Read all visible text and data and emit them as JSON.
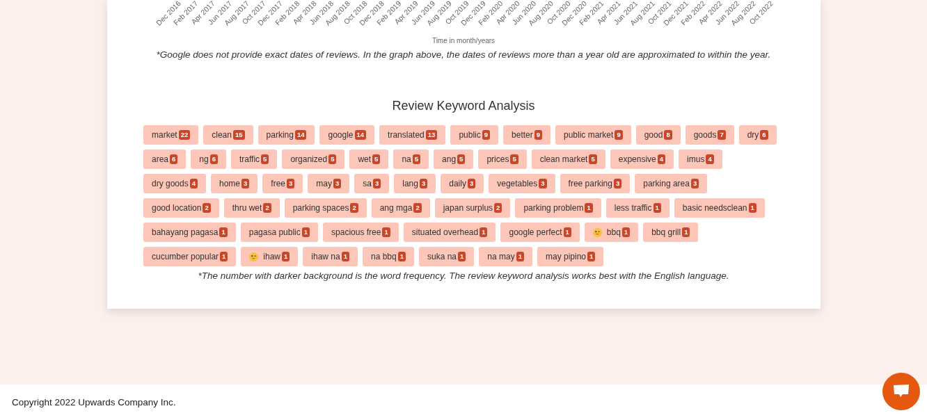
{
  "chart_axis": {
    "ticks": [
      "Dec 2016",
      "Feb 2017",
      "Apr 2017",
      "Jun 2017",
      "Aug 2017",
      "Oct 2017",
      "Dec 2017",
      "Feb 2018",
      "Apr 2018",
      "Jun 2018",
      "Aug 2018",
      "Oct 2018",
      "Dec 2018",
      "Feb 2019",
      "Apr 2019",
      "Jun 2019",
      "Aug 2019",
      "Oct 2019",
      "Dec 2019",
      "Feb 2020",
      "Apr 2020",
      "Jun 2020",
      "Aug 2020",
      "Oct 2020",
      "Dec 2020",
      "Feb 2021",
      "Apr 2021",
      "Jun 2021",
      "Aug 2021",
      "Oct 2021",
      "Dec 2021",
      "Feb 2022",
      "Apr 2022",
      "Jun 2022",
      "Aug 2022",
      "Oct 2022"
    ],
    "label": "Time in month/years"
  },
  "chart_note": "*Google does not provide exact dates of reviews. In the graph above, the dates of reviews more than a year old are approximated to within the year.",
  "keyword_title": "Review Keyword Analysis",
  "keywords": [
    {
      "word": "market",
      "count": "22",
      "kind": "word"
    },
    {
      "word": "clean",
      "count": "15",
      "kind": "word"
    },
    {
      "word": "parking",
      "count": "14",
      "kind": "word"
    },
    {
      "word": "google",
      "count": "14",
      "kind": "word"
    },
    {
      "word": "translated",
      "count": "13",
      "kind": "word"
    },
    {
      "word": "public",
      "count": "9",
      "kind": "word"
    },
    {
      "word": "better",
      "count": "9",
      "kind": "word"
    },
    {
      "word": "public market",
      "count": "9",
      "kind": "word"
    },
    {
      "word": "good",
      "count": "8",
      "kind": "word"
    },
    {
      "word": "goods",
      "count": "7",
      "kind": "word"
    },
    {
      "word": "dry",
      "count": "6",
      "kind": "word"
    },
    {
      "word": "area",
      "count": "6",
      "kind": "word"
    },
    {
      "word": "ng",
      "count": "6",
      "kind": "word"
    },
    {
      "word": "traffic",
      "count": "5",
      "kind": "word"
    },
    {
      "word": "organized",
      "count": "5",
      "kind": "word"
    },
    {
      "word": "wet",
      "count": "5",
      "kind": "word"
    },
    {
      "word": "na",
      "count": "5",
      "kind": "word"
    },
    {
      "word": "ang",
      "count": "5",
      "kind": "word"
    },
    {
      "word": "prices",
      "count": "5",
      "kind": "word"
    },
    {
      "word": "clean market",
      "count": "5",
      "kind": "word"
    },
    {
      "word": "expensive",
      "count": "4",
      "kind": "word"
    },
    {
      "word": "imus",
      "count": "4",
      "kind": "word"
    },
    {
      "word": "dry goods",
      "count": "4",
      "kind": "word"
    },
    {
      "word": "home",
      "count": "3",
      "kind": "word"
    },
    {
      "word": "free",
      "count": "3",
      "kind": "word"
    },
    {
      "word": "may",
      "count": "3",
      "kind": "word"
    },
    {
      "word": "sa",
      "count": "3",
      "kind": "word"
    },
    {
      "word": "lang",
      "count": "3",
      "kind": "word"
    },
    {
      "word": "daily",
      "count": "3",
      "kind": "word"
    },
    {
      "word": "vegetables",
      "count": "3",
      "kind": "word"
    },
    {
      "word": "free parking",
      "count": "3",
      "kind": "word"
    },
    {
      "word": "parking area",
      "count": "3",
      "kind": "word"
    },
    {
      "word": "good location",
      "count": "2",
      "kind": "word"
    },
    {
      "word": "thru wet",
      "count": "2",
      "kind": "word"
    },
    {
      "word": "parking spaces",
      "count": "2",
      "kind": "word"
    },
    {
      "word": "ang mga",
      "count": "2",
      "kind": "word"
    },
    {
      "word": "japan surplus",
      "count": "2",
      "kind": "word"
    },
    {
      "word": "parking problem",
      "count": "1",
      "kind": "word"
    },
    {
      "word": "less traffic",
      "count": "1",
      "kind": "word"
    },
    {
      "word": "basic needsclean",
      "count": "1",
      "kind": "word"
    },
    {
      "word": "bahayang pagasa",
      "count": "1",
      "kind": "word"
    },
    {
      "word": "pagasa public",
      "count": "1",
      "kind": "word"
    },
    {
      "word": "spacious free",
      "count": "1",
      "kind": "word"
    },
    {
      "word": "situated overhead",
      "count": "1",
      "kind": "word"
    },
    {
      "word": "google perfect",
      "count": "1",
      "kind": "word"
    },
    {
      "word": "bbq",
      "count": "1",
      "kind": "emoji"
    },
    {
      "word": "bbq grill",
      "count": "1",
      "kind": "word"
    },
    {
      "word": "cucumber popular",
      "count": "1",
      "kind": "word"
    },
    {
      "word": "ihaw",
      "count": "1",
      "kind": "emoji"
    },
    {
      "word": "ihaw na",
      "count": "1",
      "kind": "word"
    },
    {
      "word": "na bbq",
      "count": "1",
      "kind": "word"
    },
    {
      "word": "suka na",
      "count": "1",
      "kind": "word"
    },
    {
      "word": "na may",
      "count": "1",
      "kind": "word"
    },
    {
      "word": "may pipino",
      "count": "1",
      "kind": "word"
    }
  ],
  "keyword_note": "*The number with darker background is the word frequency. The review keyword analysis works best with the English language.",
  "footer": {
    "copyright": "Copyright 2022 Upwards Company Inc."
  }
}
